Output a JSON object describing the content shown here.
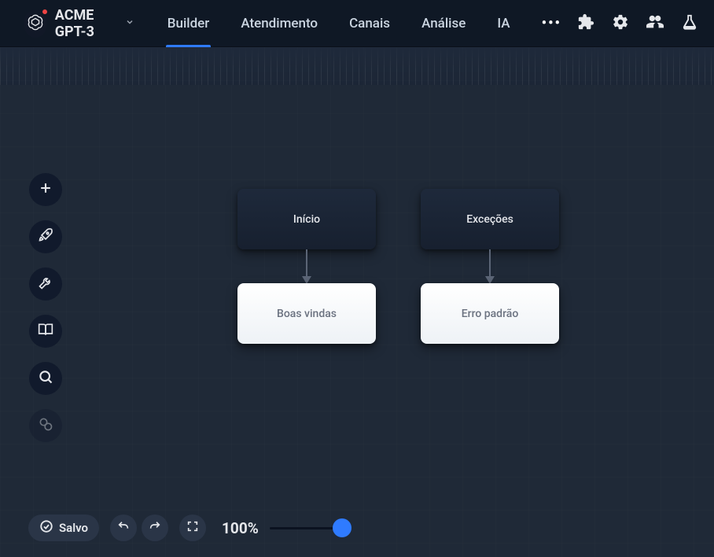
{
  "header": {
    "brand": "ACME GPT-3",
    "tabs": [
      {
        "label": "Builder",
        "active": true
      },
      {
        "label": "Atendimento",
        "active": false
      },
      {
        "label": "Canais",
        "active": false
      },
      {
        "label": "Análise",
        "active": false
      },
      {
        "label": "IA",
        "active": false
      }
    ],
    "more_glyph": "•••"
  },
  "nodes": {
    "inicio": "Início",
    "excecoes": "Exceções",
    "boas_vindas": "Boas vindas",
    "erro_padrao": "Erro padrão"
  },
  "bottom": {
    "status": "Salvo",
    "zoom": "100%"
  },
  "colors": {
    "accent": "#2f7bff",
    "bg": "#1f2937",
    "header_bg": "#0f1825",
    "badge": "#ef4444"
  }
}
